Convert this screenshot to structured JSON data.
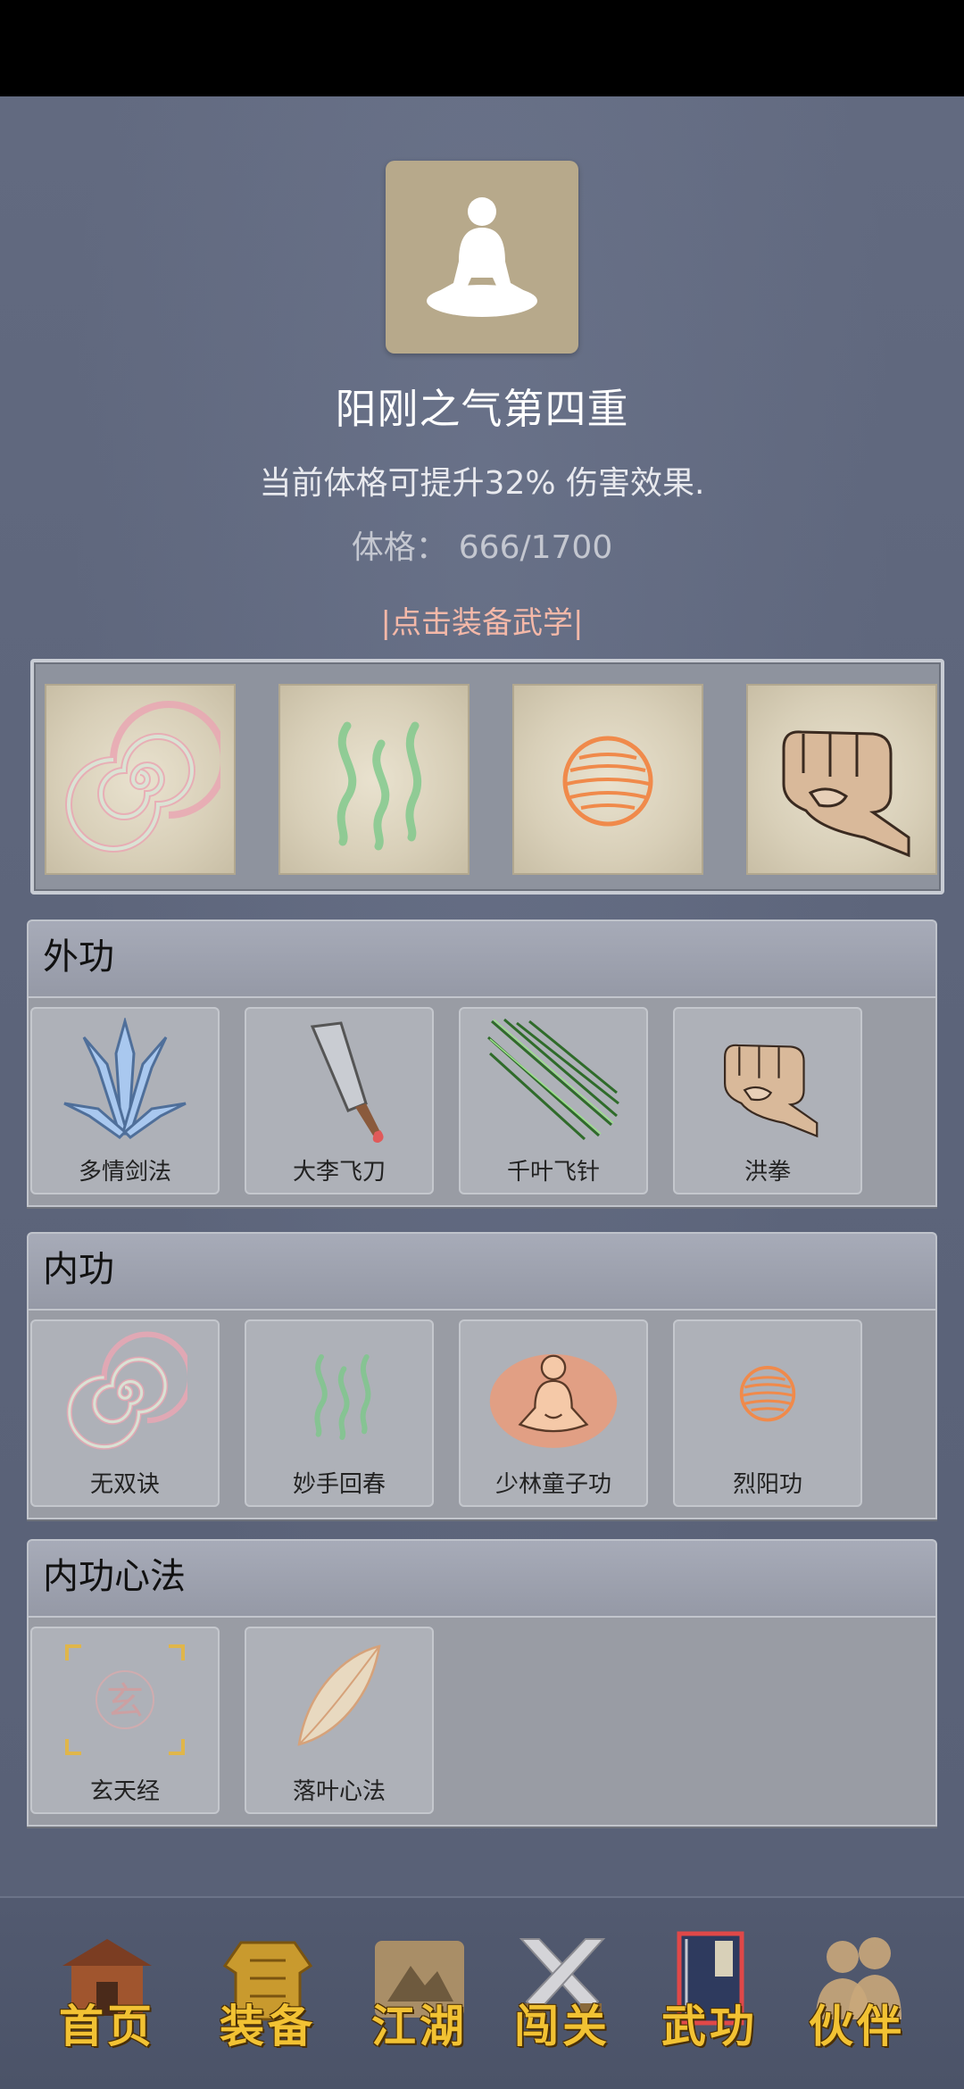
{
  "header": {
    "portrait_icon": "meditation-figure-icon",
    "title": "阳刚之气第四重",
    "subtitle": "当前体格可提升32% 伤害效果.",
    "stat_label": "体格：",
    "stat_value": "666/1700",
    "equip_hint": "|点击装备武学|"
  },
  "equipped": [
    {
      "icon": "spiral-icon"
    },
    {
      "icon": "wave-icon"
    },
    {
      "icon": "fire-orb-icon"
    },
    {
      "icon": "fist-icon"
    }
  ],
  "sections": {
    "external": {
      "title": "外功",
      "items": [
        {
          "label": "多情剑法",
          "icon": "swords-icon"
        },
        {
          "label": "大李飞刀",
          "icon": "cleaver-icon"
        },
        {
          "label": "千叶飞针",
          "icon": "needles-icon"
        },
        {
          "label": "洪拳",
          "icon": "fist-icon"
        }
      ]
    },
    "internal": {
      "title": "内功",
      "items": [
        {
          "label": "无双诀",
          "icon": "spiral-icon"
        },
        {
          "label": "妙手回春",
          "icon": "wave-icon"
        },
        {
          "label": "少林童子功",
          "icon": "buddha-icon"
        },
        {
          "label": "烈阳功",
          "icon": "fire-orb-icon"
        }
      ]
    },
    "mind": {
      "title": "内功心法",
      "items": [
        {
          "label": "玄天经",
          "icon": "xuan-rune-icon",
          "glyph": "玄"
        },
        {
          "label": "落叶心法",
          "icon": "leaf-icon"
        }
      ]
    }
  },
  "nav": [
    {
      "label": "首页",
      "icon": "house-icon"
    },
    {
      "label": "装备",
      "icon": "armor-icon"
    },
    {
      "label": "江湖",
      "icon": "scroll-map-icon"
    },
    {
      "label": "闯关",
      "icon": "crossed-swords-icon"
    },
    {
      "label": "武功",
      "icon": "book-icon",
      "active": true
    },
    {
      "label": "伙伴",
      "icon": "partners-icon"
    }
  ],
  "colors": {
    "accent_hint": "#f4b8a8",
    "nav_label": "#f2c233",
    "background": "#5f677d"
  }
}
